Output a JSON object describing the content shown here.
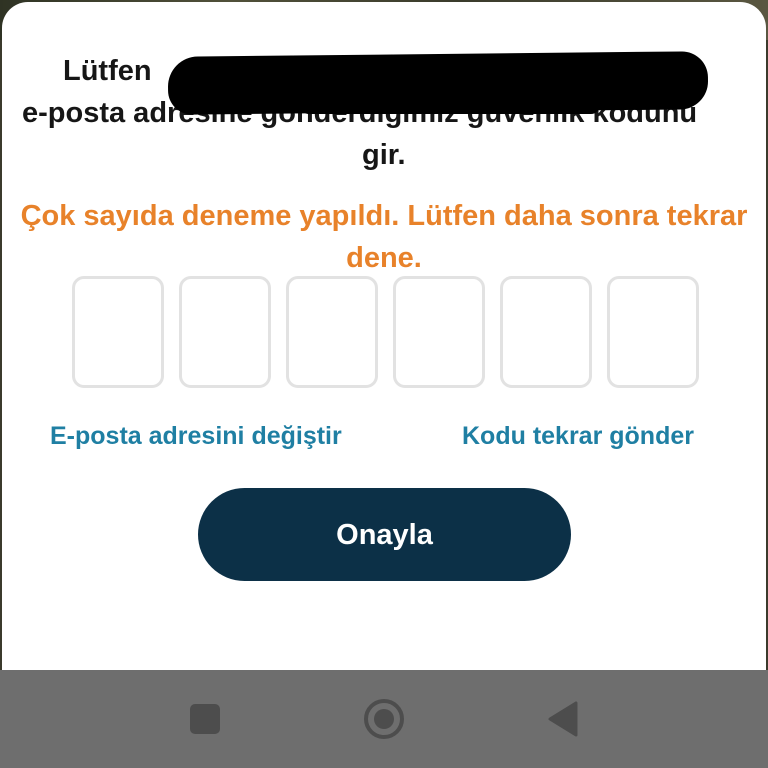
{
  "dialog": {
    "instruction_line1": "Lütfen",
    "instruction_line2": "e-posta adresine gönderdiğimiz güvenlik kodunu",
    "instruction_line3": "gir.",
    "error_message": "Çok sayıda deneme yapıldı. Lütfen daha sonra tekrar dene.",
    "code_inputs": [
      "",
      "",
      "",
      "",
      "",
      ""
    ],
    "change_email_link": "E-posta adresini değiştir",
    "resend_code_link": "Kodu tekrar gönder",
    "confirm_button": "Onayla"
  },
  "colors": {
    "error": "#e8822a",
    "link": "#1f7fa3",
    "primary_button": "#0c3047"
  },
  "navbar": {
    "icons": [
      "recents-square-icon",
      "home-circle-icon",
      "back-triangle-icon"
    ]
  }
}
